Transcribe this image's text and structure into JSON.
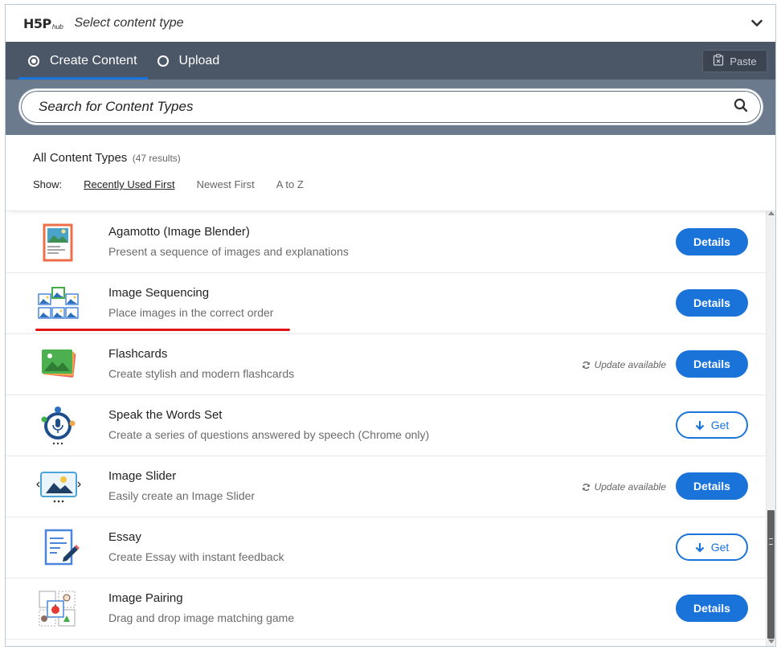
{
  "header": {
    "logo_text": "H5P",
    "logo_sub": "hub",
    "title": "Select content type"
  },
  "tabs": [
    {
      "label": "Create Content",
      "active": true
    },
    {
      "label": "Upload",
      "active": false
    }
  ],
  "paste_label": "Paste",
  "search": {
    "placeholder": "Search for Content Types",
    "value": ""
  },
  "results": {
    "title": "All Content Types",
    "count": "(47 results)",
    "show_label": "Show:",
    "sort_options": [
      "Recently Used First",
      "Newest First",
      "A to Z"
    ],
    "selected_sort": "Recently Used First"
  },
  "items": [
    {
      "name": "Agamotto (Image Blender)",
      "desc": "Present a sequence of images and explanations",
      "action": "Details",
      "update": "",
      "icon": "agamotto-icon"
    },
    {
      "name": "Image Sequencing",
      "desc": "Place images in the correct order",
      "action": "Details",
      "update": "",
      "icon": "image-sequencing-icon"
    },
    {
      "name": "Flashcards",
      "desc": "Create stylish and modern flashcards",
      "action": "Details",
      "update": "Update available",
      "icon": "flashcards-icon"
    },
    {
      "name": "Speak the Words Set",
      "desc": "Create a series of questions answered by speech (Chrome only)",
      "action": "Get",
      "update": "",
      "icon": "speak-words-icon"
    },
    {
      "name": "Image Slider",
      "desc": "Easily create an Image Slider",
      "action": "Details",
      "update": "Update available",
      "icon": "image-slider-icon"
    },
    {
      "name": "Essay",
      "desc": "Create Essay with instant feedback",
      "action": "Get",
      "update": "",
      "icon": "essay-icon"
    },
    {
      "name": "Image Pairing",
      "desc": "Drag and drop image matching game",
      "action": "Details",
      "update": "",
      "icon": "image-pairing-icon"
    }
  ],
  "colors": {
    "accent": "#1a73d9",
    "tabs_bar": "#4b5766",
    "search_bar": "#6b7a8c",
    "highlight_underline": "#e11515"
  }
}
